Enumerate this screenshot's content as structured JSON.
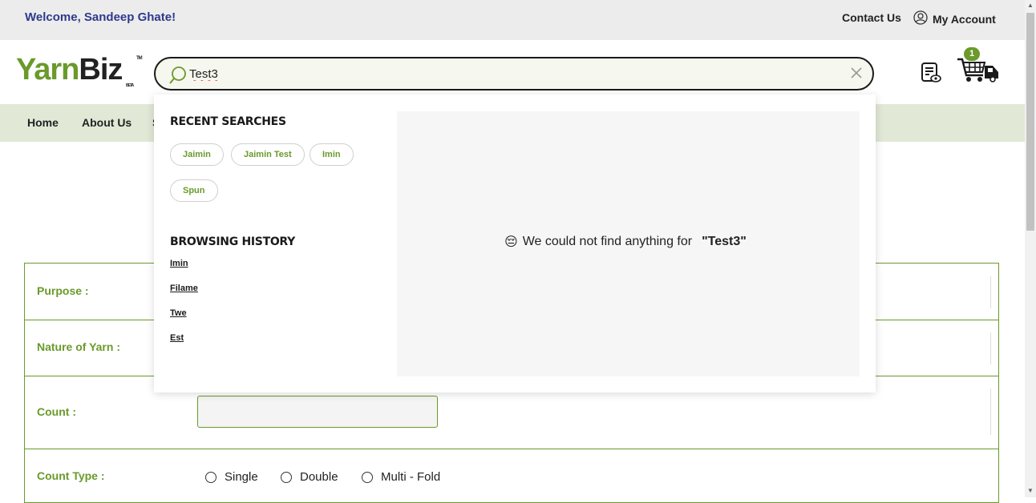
{
  "header": {
    "welcome": "Welcome, Sandeep Ghate!",
    "contact": "Contact Us",
    "account": "My Account"
  },
  "logo": {
    "part1": "Yarn",
    "part2": "Biz",
    "tm": "TM",
    "beta": "BETA"
  },
  "search": {
    "value": "Test3",
    "placeholder": ""
  },
  "cart": {
    "count": "1"
  },
  "nav": {
    "items": [
      {
        "label": "Home"
      },
      {
        "label": "About Us"
      },
      {
        "label": "S"
      }
    ]
  },
  "dropdown": {
    "recent_heading": "RECENT SEARCHES",
    "recent": [
      "Jaimin",
      "Jaimin Test",
      "Imin",
      "Spun"
    ],
    "history_heading": "BROWSING HISTORY",
    "history": [
      "Imin",
      "Filame",
      "Twe",
      "Est"
    ],
    "no_result_text": "We could not find anything for",
    "no_result_query": "\"Test3\"",
    "no_result_emoji": "😔"
  },
  "form": {
    "purpose_label": "Purpose :",
    "nature_label": "Nature of Yarn :",
    "count_label": "Count :",
    "count_type_label": "Count Type :",
    "count_type_options": [
      "Single",
      "Double",
      "Multi - Fold"
    ]
  },
  "colors": {
    "brand_green": "#6a9a2b",
    "welcome_blue": "#2d3a8c",
    "nav_bg": "#e1e8d6"
  }
}
